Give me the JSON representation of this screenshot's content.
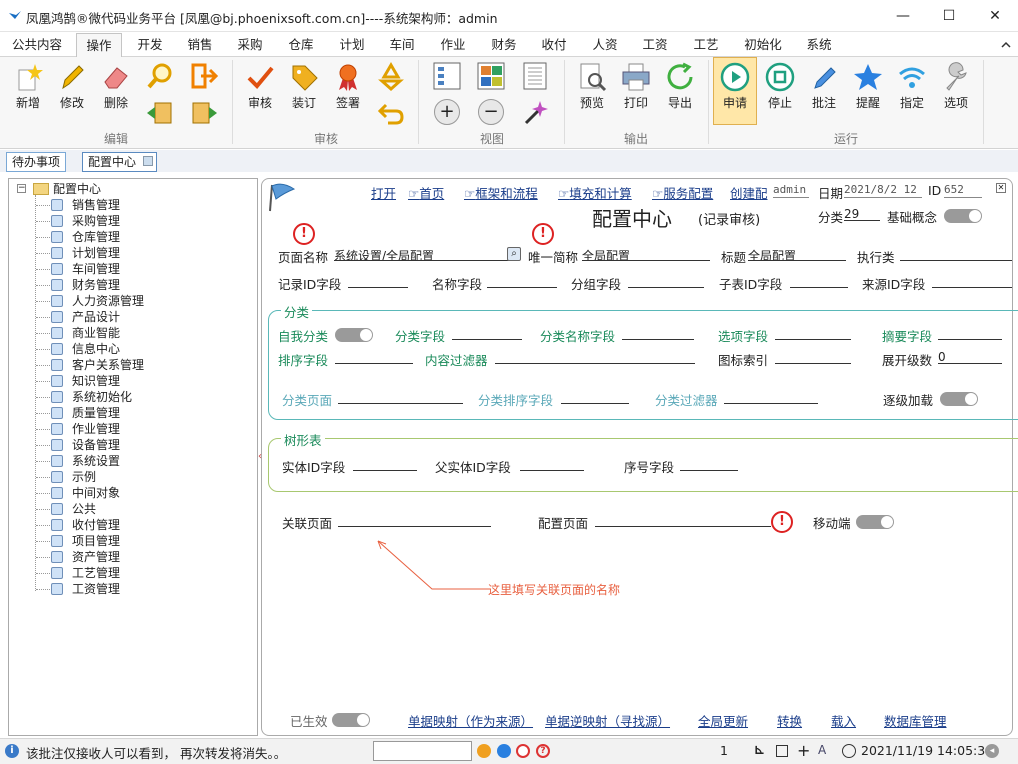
{
  "window": {
    "title": "凤凰鸿鹄®微代码业务平台  [凤凰@bj.phoenixsoft.com.cn]----系统架构师：admin",
    "min": "—",
    "max": "☐",
    "close": "✕"
  },
  "menu": [
    "公共内容",
    "操作",
    "开发",
    "销售",
    "采购",
    "仓库",
    "计划",
    "车间",
    "作业",
    "财务",
    "收付",
    "人资",
    "工资",
    "工艺",
    "初始化",
    "系统"
  ],
  "ribbon": {
    "buttons": [
      "新增",
      "修改",
      "删除",
      "审核",
      "装订",
      "签署",
      "预览",
      "打印",
      "导出",
      "申请",
      "停止",
      "批注",
      "提醒",
      "指定",
      "选项"
    ],
    "groups": [
      "编辑",
      "审核",
      "视图",
      "输出",
      "运行"
    ]
  },
  "tabs": [
    "待办事项",
    "配置中心"
  ],
  "tree": {
    "root": "配置中心",
    "items": [
      "销售管理",
      "采购管理",
      "仓库管理",
      "计划管理",
      "车间管理",
      "财务管理",
      "人力资源管理",
      "产品设计",
      "商业智能",
      "信息中心",
      "客户关系管理",
      "知识管理",
      "系统初始化",
      "质量管理",
      "作业管理",
      "设备管理",
      "系统设置",
      "示例",
      "中间对象",
      "公共",
      "收付管理",
      "项目管理",
      "资产管理",
      "工艺管理",
      "工资管理"
    ]
  },
  "main": {
    "links": [
      "打开",
      "首页",
      "框架和流程",
      "填充和计算",
      "服务配置",
      "创建配"
    ],
    "link_prefix": "☞",
    "user": "admin",
    "date_label": "日期",
    "date_value": "2021/8/2 12",
    "id_label": "ID",
    "id_value": "652",
    "title": "配置中心",
    "subtitle": "(记录审核)",
    "category_label": "分类",
    "category_value": "29",
    "basic_label": "基础概念",
    "row1": {
      "page_name_label": "页面名称",
      "page_name_value": "系统设置/全局配置",
      "alias_label": "唯一简称",
      "alias_value": "全局配置",
      "title_label": "标题",
      "title_value": "全局配置",
      "exec_label": "执行类"
    },
    "row2": [
      "记录ID字段",
      "名称字段",
      "分组字段",
      "子表ID字段",
      "来源ID字段"
    ],
    "cat_section": {
      "legend": "分类",
      "self_label": "自我分类",
      "field_label": "分类字段",
      "name_field_label": "分类名称字段",
      "option_field_label": "选项字段",
      "summary_field_label": "摘要字段",
      "sort_field_label": "排序字段",
      "content_filter_label": "内容过滤器",
      "icon_index_label": "图标索引",
      "expand_level_label": "展开级数",
      "expand_level_value": "0",
      "page_label": "分类页面",
      "sort_page_label": "分类排序字段",
      "filter_label": "分类过滤器",
      "lazy_label": "逐级加载"
    },
    "tree_section": {
      "legend": "树形表",
      "entity_label": "实体ID字段",
      "parent_label": "父实体ID字段",
      "seq_label": "序号字段"
    },
    "related_label": "关联页面",
    "config_page_label": "配置页面",
    "mobile_label": "移动端",
    "annotation": "这里填写关联页面的名称",
    "effective_label": "已生效",
    "bottom_links": [
      "单据映射（作为来源）",
      "单据逆映射（寻找源）",
      "全局更新",
      "转换",
      "载入",
      "数据库管理"
    ]
  },
  "status": {
    "note": "该批注仅接收人可以看到，  再次转发将消失。。",
    "page": "1",
    "datetime": "2021/11/19 14:05:39"
  },
  "colors": {
    "accent_tab": "#7aa8d6",
    "green_label": "#1a8a5a",
    "link": "#1a3d8a",
    "warn": "#dd2222",
    "active_btn": "#ffe7a8"
  }
}
